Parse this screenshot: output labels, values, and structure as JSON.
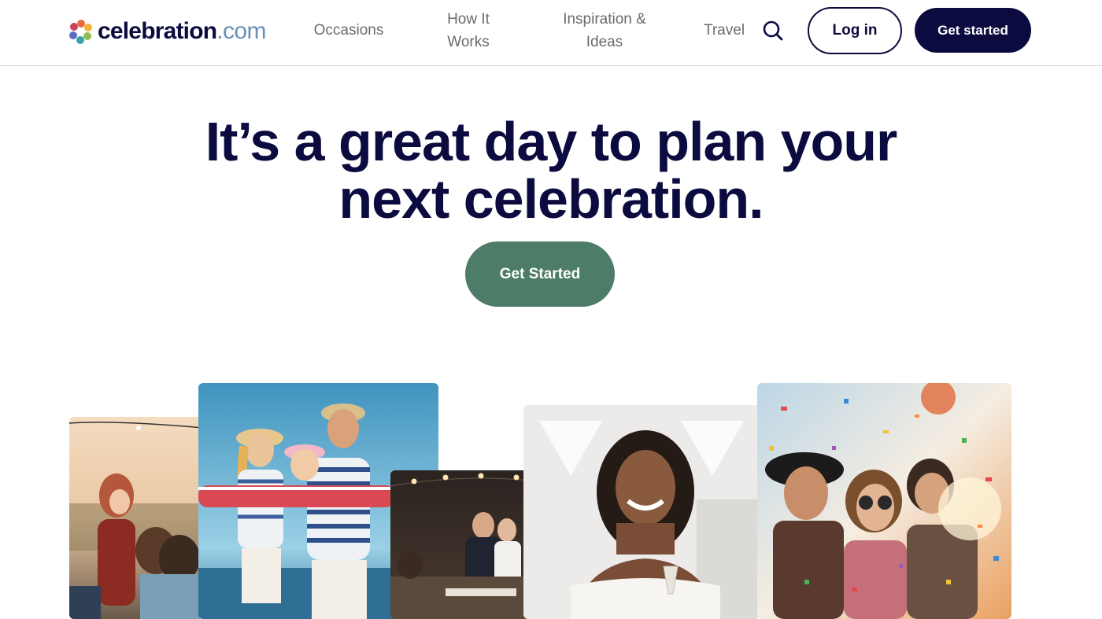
{
  "brand": {
    "name": "celebration",
    "tld": ".com"
  },
  "nav": {
    "occasions": "Occasions",
    "how_it_works_line1": "How It",
    "how_it_works_line2": "Works",
    "inspiration_line1": "Inspiration &",
    "inspiration_line2": "Ideas",
    "travel": "Travel"
  },
  "header_actions": {
    "search_icon": "search-icon",
    "login_label": "Log in",
    "get_started_label": "Get started"
  },
  "hero": {
    "title_line1": "It’s a great day to plan your",
    "title_line2": "next celebration.",
    "cta_label": "Get Started"
  },
  "colors": {
    "navy": "#0c0b3f",
    "cta_green": "#4d7d68",
    "nav_gray": "#6b6b6b",
    "tld_blue": "#6a8fb8"
  },
  "photos": [
    "outdoor-dinner-party-photo",
    "family-beach-photo",
    "wedding-reception-photo",
    "smiling-woman-toast-photo",
    "confetti-party-photo"
  ]
}
